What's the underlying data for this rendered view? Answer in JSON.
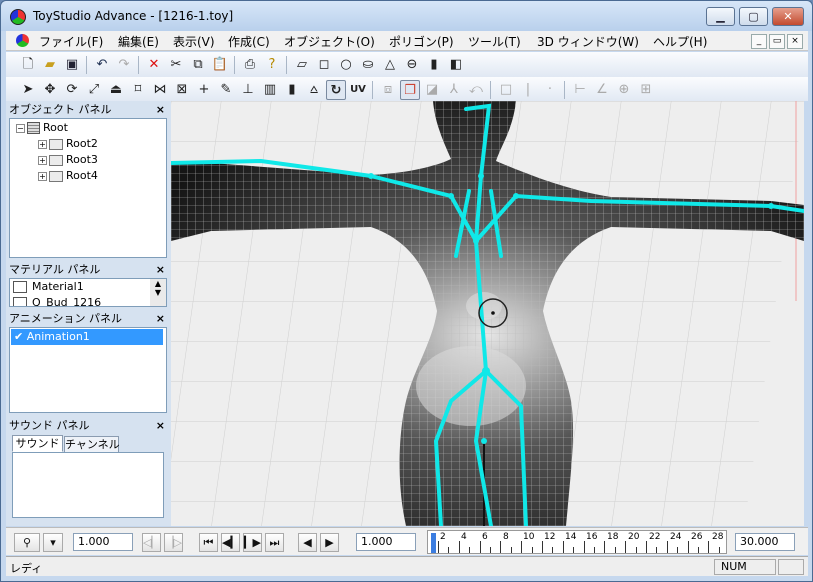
{
  "window": {
    "title": "ToyStudio Advance - [1216-1.toy]",
    "controls": {
      "minimize": "▁",
      "maximize": "▢",
      "close": "✕"
    }
  },
  "menubar": {
    "items": [
      "ファイル(F)",
      "編集(E)",
      "表示(V)",
      "作成(C)",
      "オブジェクト(O)",
      "ポリゴン(P)",
      "ツール(T)",
      "3D ウィンドウ(W)",
      "ヘルプ(H)"
    ],
    "mdi_controls": [
      "_",
      "▭",
      "×"
    ]
  },
  "toolbar1": {
    "icons": [
      "new-file-icon",
      "open-folder-icon",
      "save-icon",
      "undo-icon",
      "redo-icon",
      "delete-icon",
      "cut-icon",
      "copy-icon",
      "paste-icon",
      "print-icon",
      "help-icon",
      "plane-icon",
      "cube-icon",
      "circle-icon",
      "cylinder-icon",
      "cone-icon",
      "torus-icon",
      "box-bar-icon",
      "cone-side-icon"
    ]
  },
  "toolbar2": {
    "uv_label": "UV"
  },
  "panels": {
    "object": {
      "title": "オブジェクト パネル",
      "close": "×",
      "tree": [
        {
          "label": "Root",
          "level": 0
        },
        {
          "label": "Root2",
          "level": 1
        },
        {
          "label": "Root3",
          "level": 1
        },
        {
          "label": "Root4",
          "level": 1
        }
      ]
    },
    "material": {
      "title": "マテリアル パネル",
      "close": "×",
      "items": [
        "Material1",
        "Q_Bud_1216"
      ]
    },
    "animation": {
      "title": "アニメーション パネル",
      "close": "×",
      "items": [
        "Animation1"
      ]
    },
    "sound": {
      "title": "サウンド パネル",
      "close": "×",
      "tabs": [
        "サウンド",
        "チャンネル"
      ]
    }
  },
  "playback": {
    "speed_value": "1.000",
    "frame_value": "1.000",
    "end_value": "30.000",
    "timeline_ticks": [
      "2",
      "4",
      "6",
      "8",
      "10",
      "12",
      "14",
      "16",
      "18",
      "20",
      "22",
      "24",
      "26",
      "28"
    ]
  },
  "status": {
    "text": "レディ",
    "num": "NUM"
  },
  "colors": {
    "bone": "#10e8e8",
    "accent": "#3399ff"
  }
}
